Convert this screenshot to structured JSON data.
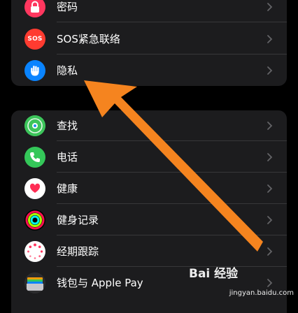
{
  "group1": {
    "items": [
      {
        "label": "密码",
        "icon": "lock-icon",
        "color": "#ff375f"
      },
      {
        "label": "SOS紧急联络",
        "icon": "sos-icon",
        "icon_text": "SOS",
        "color": "#ff3b30"
      },
      {
        "label": "隐私",
        "icon": "hand-icon",
        "color": "#0a84ff"
      }
    ]
  },
  "group2": {
    "items": [
      {
        "label": "查找",
        "icon": "find-my-icon",
        "color": "#34c759"
      },
      {
        "label": "电话",
        "icon": "phone-icon",
        "color": "#34c759"
      },
      {
        "label": "健康",
        "icon": "health-heart-icon",
        "color": "#ff2d55"
      },
      {
        "label": "健身记录",
        "icon": "activity-rings-icon",
        "color": "#fa114f"
      },
      {
        "label": "经期跟踪",
        "icon": "cycle-tracking-icon",
        "color": "#ff375f"
      },
      {
        "label": "钱包与 Apple Pay",
        "icon": "wallet-icon",
        "color": "#8e8e93"
      }
    ]
  },
  "watermark": {
    "logo": "Bai 经验",
    "url": "jingyan.baidu.com"
  },
  "colors": {
    "background": "#000000",
    "group_bg": "#1c1c1e",
    "separator": "#38383a",
    "chevron": "#636366",
    "arrow": "#f5841f"
  }
}
